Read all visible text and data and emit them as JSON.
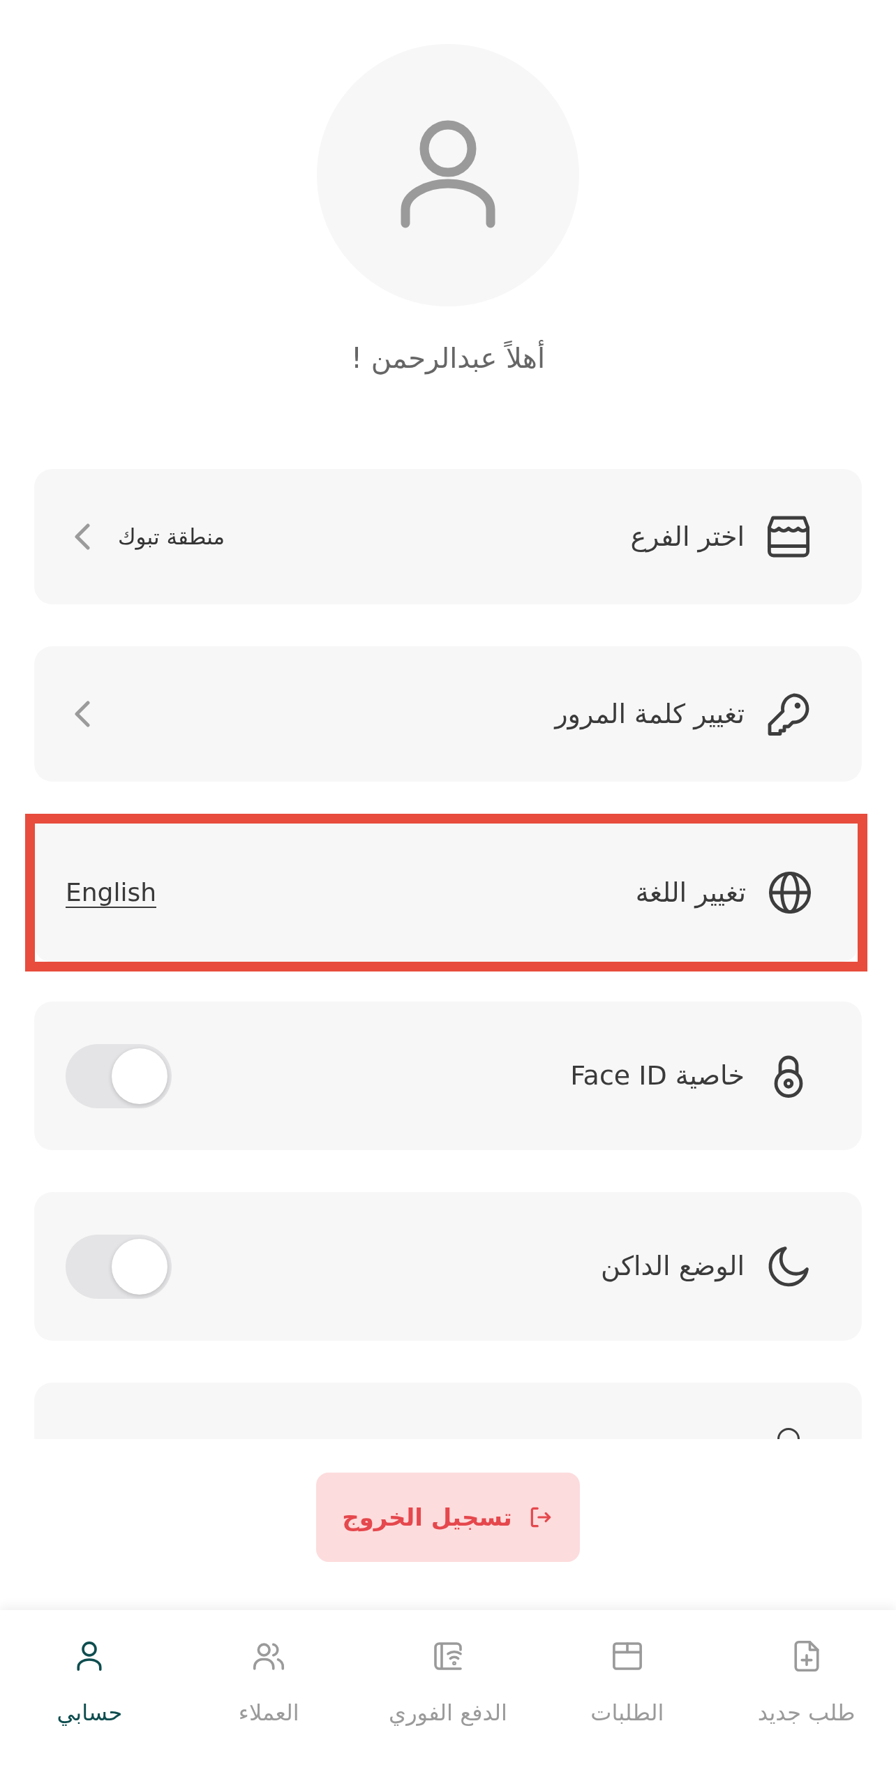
{
  "profile": {
    "greeting": "أهلاً عبدالرحمن !"
  },
  "settings": [
    {
      "kind": "link",
      "label": "اختر الفرع",
      "value": "منطقة تبوك",
      "highlighted": false
    },
    {
      "kind": "link",
      "label": "تغيير كلمة المرور",
      "highlighted": false
    },
    {
      "kind": "language",
      "label": "تغيير اللغة",
      "value": "English",
      "highlighted": true
    },
    {
      "kind": "toggle",
      "label": "خاصية Face ID",
      "on": false,
      "highlighted": false
    },
    {
      "kind": "toggle",
      "label": "الوضع الداكن",
      "on": false,
      "highlighted": false
    },
    {
      "kind": "cut_off",
      "highlighted": false
    }
  ],
  "logout": {
    "label": "تسجيل الخروج"
  },
  "bottom_nav": [
    {
      "label": "طلب جديد",
      "selected": false
    },
    {
      "label": "الطلبات",
      "selected": false
    },
    {
      "label": "الدفع الفوري",
      "selected": false
    },
    {
      "label": "العملاء",
      "selected": false
    },
    {
      "label": "حسابي",
      "selected": true
    }
  ]
}
